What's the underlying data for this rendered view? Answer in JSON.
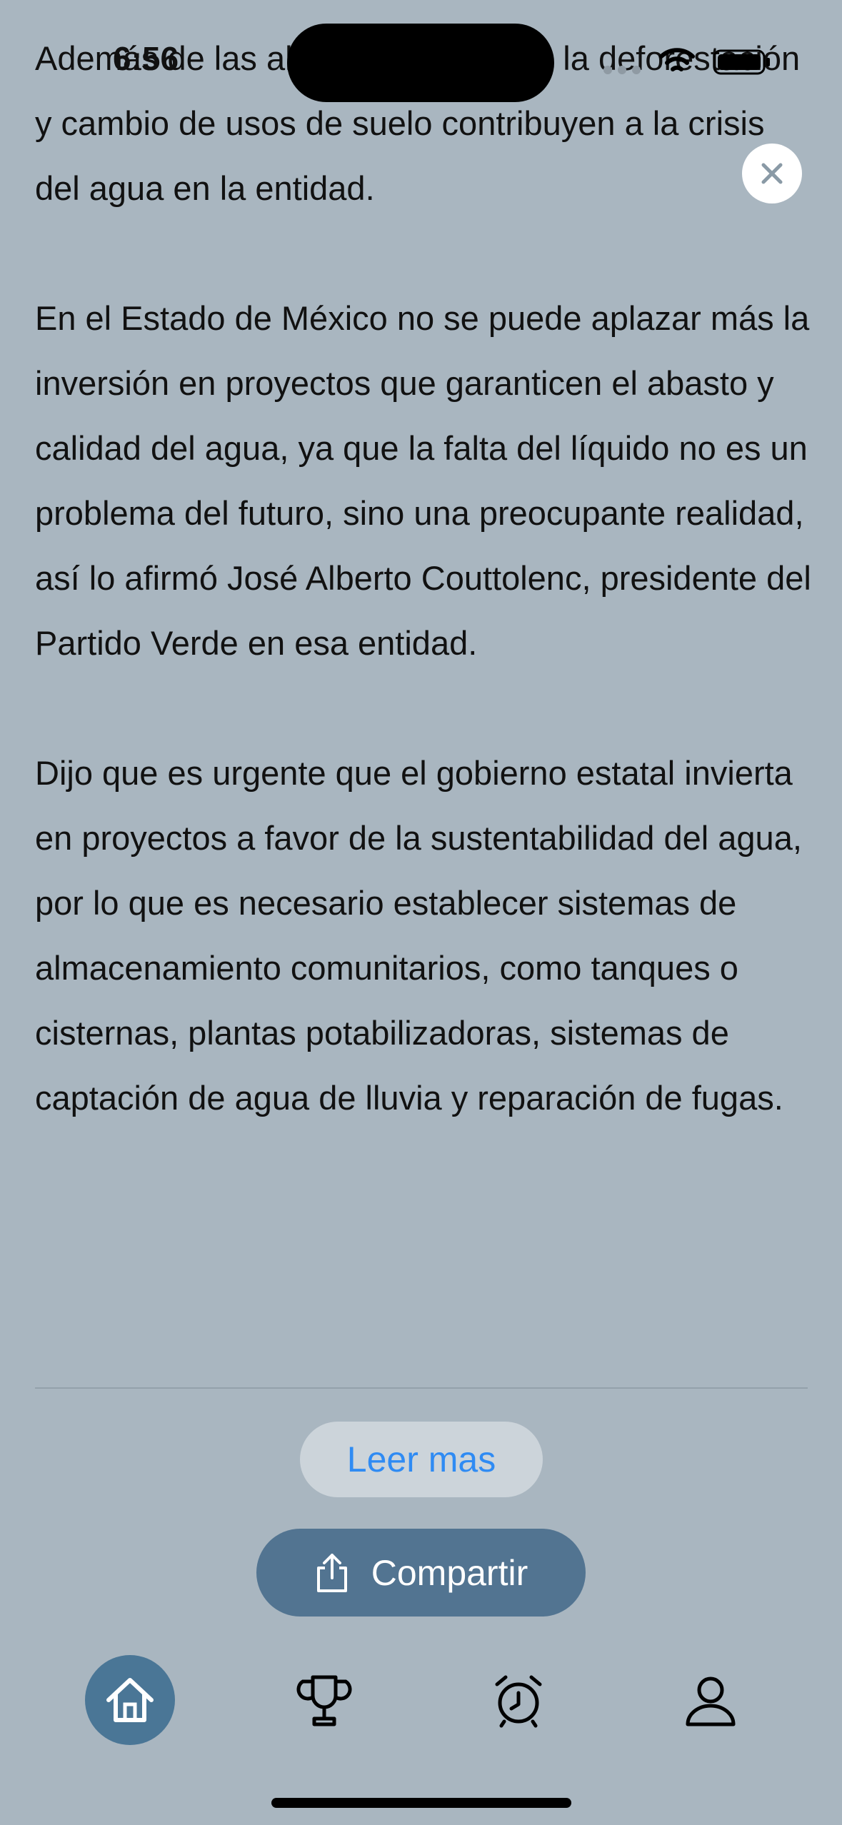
{
  "status_bar": {
    "time": "6:56"
  },
  "article": {
    "paragraphs": [
      "Además de las altas temperaturas, la deforestación y cambio de usos de suelo contribuyen a la crisis del agua en la entidad.",
      "En el Estado de México no se puede aplazar más la inversión en proyectos que garanticen el abasto y calidad del agua, ya que la falta del líquido no es un problema del futuro, sino una preocupante realidad, así lo afirmó José Alberto Couttolenc, presidente del Partido Verde en esa entidad.",
      "Dijo que es urgente que el gobierno estatal invierta en proyectos a favor de la sustentabilidad del agua, por lo que es necesario establecer sistemas de almacenamiento comunitarios, como tanques o cisternas, plantas potabilizadoras, sistemas de captación de agua de lluvia y reparación de fugas."
    ]
  },
  "actions": {
    "read_more_label": "Leer mas",
    "share_label": "Compartir"
  },
  "tabbar": {
    "items": [
      {
        "icon": "home-icon",
        "active": true
      },
      {
        "icon": "trophy-icon",
        "active": false
      },
      {
        "icon": "alarm-icon",
        "active": false
      },
      {
        "icon": "profile-icon",
        "active": false
      }
    ]
  },
  "colors": {
    "background": "#a9b6c0",
    "accent": "#527491",
    "link": "#2f8bf3"
  }
}
